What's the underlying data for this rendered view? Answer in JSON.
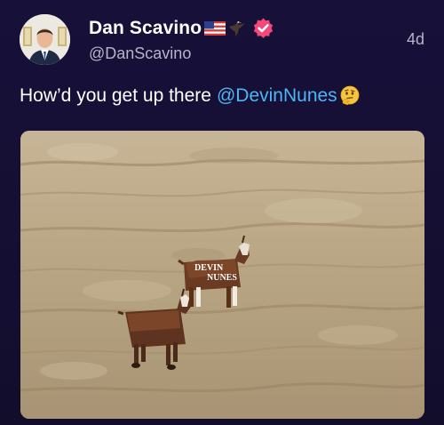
{
  "author": {
    "display_name": "Dan Scavino",
    "handle": "@DanScavino",
    "emoji_icons": [
      "us-flag-icon",
      "eagle-icon"
    ],
    "verified_icon": "verified-badge-icon"
  },
  "timestamp": "4d",
  "tweet": {
    "text": "How’d you get up there",
    "mention": "@DevinNunes",
    "trailing_icon": "thinking-face-icon"
  },
  "media": {
    "goat_label_line1": "DEVIN",
    "goat_label_line2": "NUNES"
  },
  "colors": {
    "background": "#150f30",
    "mention": "#4fb4f5",
    "verified": "#f4487b",
    "secondary_text": "#b7b3c8"
  }
}
